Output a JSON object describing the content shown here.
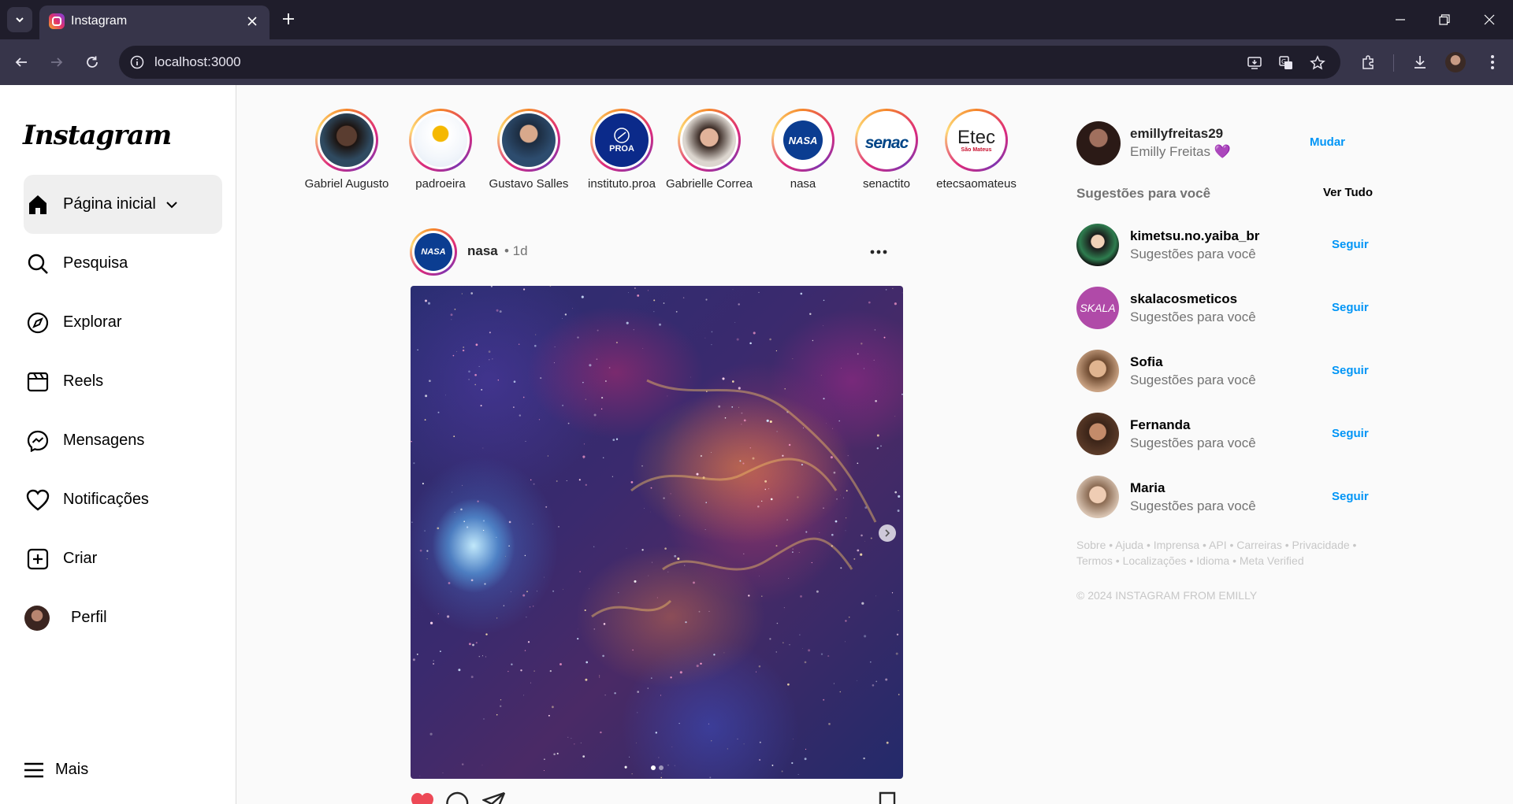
{
  "browser": {
    "tab_title": "Instagram",
    "url": "localhost:3000"
  },
  "sidebar": {
    "logo": "Instagram",
    "items": [
      {
        "label": "Página inicial",
        "icon": "home-icon"
      },
      {
        "label": "Pesquisa",
        "icon": "search-icon"
      },
      {
        "label": "Explorar",
        "icon": "compass-icon"
      },
      {
        "label": "Reels",
        "icon": "reels-icon"
      },
      {
        "label": "Mensagens",
        "icon": "messenger-icon"
      },
      {
        "label": "Notificações",
        "icon": "heart-icon"
      },
      {
        "label": "Criar",
        "icon": "plus-square-icon"
      },
      {
        "label": "Perfil",
        "icon": "avatar"
      }
    ],
    "more_label": "Mais"
  },
  "stories": [
    {
      "name": "Gabriel Augusto"
    },
    {
      "name": "padroeira"
    },
    {
      "name": "Gustavo Salles"
    },
    {
      "name": "instituto.proa",
      "logo_text": "PROA"
    },
    {
      "name": "Gabrielle Correa"
    },
    {
      "name": "nasa",
      "logo_text": "NASA"
    },
    {
      "name": "senactito",
      "logo_text": "senac"
    },
    {
      "name": "etecsaomateus",
      "logo_text": "Etec",
      "logo_sub": "São Mateus"
    }
  ],
  "post": {
    "username": "nasa",
    "avatar_text": "NASA",
    "time": "• 1d",
    "carousel_index": 1,
    "carousel_total": 2
  },
  "right": {
    "me": {
      "username": "emillyfreitas29",
      "name": "Emilly Freitas 💜",
      "switch_label": "Mudar"
    },
    "suggestions_title": "Sugestões para você",
    "see_all_label": "Ver Tudo",
    "suggestions": [
      {
        "username": "kimetsu.no.yaiba_br",
        "sub": "Sugestões para você",
        "follow": "Seguir"
      },
      {
        "username": "skalacosmeticos",
        "sub": "Sugestões para você",
        "follow": "Seguir",
        "avatar_text": "SKALA"
      },
      {
        "username": "Sofia",
        "sub": "Sugestões para você",
        "follow": "Seguir"
      },
      {
        "username": "Fernanda",
        "sub": "Sugestões para você",
        "follow": "Seguir"
      },
      {
        "username": "Maria",
        "sub": "Sugestões para você",
        "follow": "Seguir"
      }
    ],
    "footer_links": "Sobre • Ajuda • Imprensa • API • Carreiras • Privacidade • Termos • Localizações • Idioma • Meta Verified",
    "copyright": "© 2024 INSTAGRAM FROM EMILLY"
  },
  "colors": {
    "accent": "#0095f6",
    "like": "#ed4956",
    "browser_dark": "#1f1d2b",
    "browser_toolbar": "#37354a"
  }
}
